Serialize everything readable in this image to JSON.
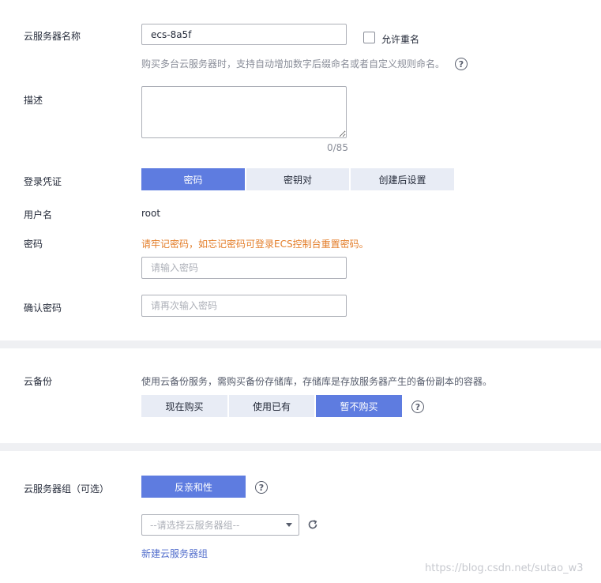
{
  "server_name": {
    "label": "云服务器名称",
    "value": "ecs-8a5f",
    "allow_duplicate_label": "允许重名",
    "hint": "购买多台云服务器时，支持自动增加数字后缀命名或者自定义规则命名。"
  },
  "description": {
    "label": "描述",
    "value": "",
    "counter": "0/85"
  },
  "credential": {
    "label": "登录凭证",
    "options": [
      "密码",
      "密钥对",
      "创建后设置"
    ],
    "selected": "密码"
  },
  "username": {
    "label": "用户名",
    "value": "root"
  },
  "password": {
    "label": "密码",
    "warning": "请牢记密码，如忘记密码可登录ECS控制台重置密码。",
    "placeholder": "请输入密码"
  },
  "confirm_password": {
    "label": "确认密码",
    "placeholder": "请再次输入密码"
  },
  "cloud_backup": {
    "label": "云备份",
    "hint": "使用云备份服务，需购买备份存储库，存储库是存放服务器产生的备份副本的容器。",
    "options": [
      "现在购买",
      "使用已有",
      "暂不购买"
    ],
    "selected": "暂不购买"
  },
  "server_group": {
    "label": "云服务器组（可选）",
    "anti_affinity_label": "反亲和性",
    "select_placeholder": "--请选择云服务器组--",
    "create_link": "新建云服务器组"
  },
  "watermark": "https://blog.csdn.net/sutao_w3",
  "colors": {
    "primary": "#5e7ce0",
    "segment_inactive": "#e8ecf5",
    "warning_text": "#e37d29",
    "link": "#526ecc",
    "divider": "#eff0f3"
  }
}
